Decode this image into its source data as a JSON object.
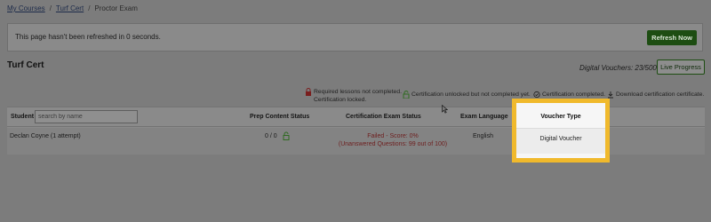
{
  "breadcrumb": {
    "items": [
      "My Courses",
      "Turf Cert",
      "Proctor Exam"
    ],
    "separator": "/"
  },
  "refresh": {
    "message": "This page hasn't been refreshed in 0 seconds.",
    "button_label": "Refresh Now"
  },
  "course": {
    "title": "Turf Cert",
    "vouchers_text": "Digital Vouchers: 23/500",
    "live_progress_label": "Live Progress"
  },
  "legend": {
    "required_line1": "Required lessons not completed.",
    "required_line2": "Certification locked.",
    "unlocked": "Certification unlocked but not completed yet.",
    "completed": "Certification completed.",
    "download": "Download certification certificate."
  },
  "table": {
    "headers": {
      "student": "Student",
      "prep": "Prep Content Status",
      "cert": "Certification Exam Status",
      "language": "Exam Language",
      "voucher": "Voucher Type"
    },
    "search_placeholder": "search by name",
    "rows": [
      {
        "student": "Declan Coyne (1 attempt)",
        "prep": "0 / 0",
        "cert_line1": "Failed - Score: 0%",
        "cert_line2": "(Unanswered Questions: 99 out of 100)",
        "language": "English",
        "voucher": "Digital Voucher"
      }
    ]
  },
  "colors": {
    "highlight_border": "#f0b92c",
    "primary_green": "#1d4d12",
    "failed_red": "#6e2020",
    "lock_red": "#7a1e1e",
    "check_green": "#2f6b21"
  },
  "icons": {
    "lock": "lock-icon",
    "unlock": "unlock-icon",
    "completed": "check-circle-icon",
    "download": "download-icon",
    "prep_status": "open-lock-icon",
    "cursor": "mouse-cursor-icon"
  }
}
